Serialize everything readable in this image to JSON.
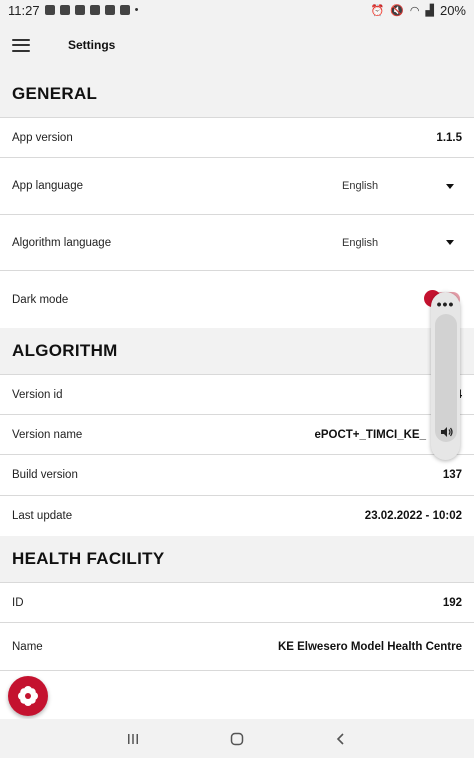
{
  "status_bar": {
    "time": "11:27",
    "battery": "20%"
  },
  "app_bar": {
    "title": "Settings",
    "menu_icon": "hamburger-menu-icon"
  },
  "general": {
    "header": "GENERAL",
    "app_version": {
      "label": "App version",
      "value": "1.1.5"
    },
    "app_language": {
      "label": "App language",
      "value": "English"
    },
    "algorithm_language": {
      "label": "Algorithm language",
      "value": "English"
    },
    "dark_mode": {
      "label": "Dark mode",
      "enabled": true
    }
  },
  "algorithm": {
    "header": "ALGORITHM",
    "version_id": {
      "label": "Version id",
      "value": "4"
    },
    "version_name": {
      "label": "Version name",
      "value": "ePOCT+_TIMCI_KE_"
    },
    "build_version": {
      "label": "Build version",
      "value": "137"
    },
    "last_update": {
      "label": "Last update",
      "value": "23.02.2022 - 10:02"
    }
  },
  "health_facility": {
    "header": "HEALTH FACILITY",
    "id": {
      "label": "ID",
      "value": "192"
    },
    "name": {
      "label": "Name",
      "value": "KE Elwesero Model Health Centre"
    }
  },
  "colors": {
    "accent": "#c4122f",
    "header_bg": "#f2f2f2",
    "divider": "#d9d9d9"
  },
  "icons": {
    "fab": "flower-logo-icon",
    "volume": "speaker-icon",
    "more": "more-dots-icon",
    "nav_recents": "recents-icon",
    "nav_home": "home-icon",
    "nav_back": "back-icon"
  }
}
